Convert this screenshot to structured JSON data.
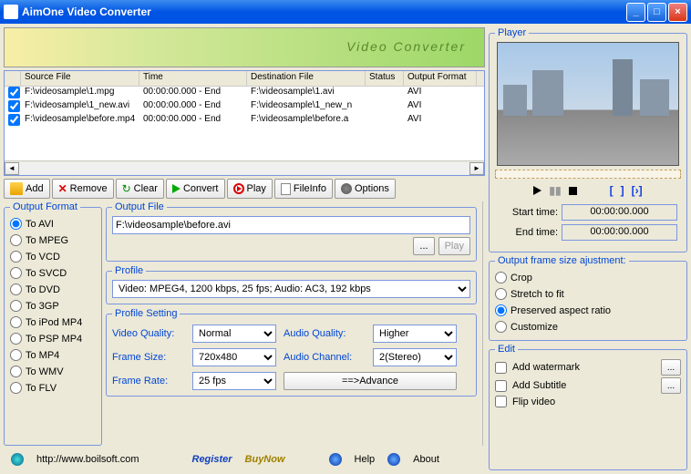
{
  "window": {
    "title": "AimOne Video Converter"
  },
  "banner": {
    "text": "Video Converter"
  },
  "table": {
    "headers": {
      "src": "Source File",
      "time": "Time",
      "dest": "Destination File",
      "status": "Status",
      "fmt": "Output Format"
    },
    "rows": [
      {
        "src": "F:\\videosample\\1.mpg",
        "time": "00:00:00.000 - End",
        "dest": "F:\\videosample\\1.avi",
        "status": "",
        "fmt": "AVI"
      },
      {
        "src": "F:\\videosample\\1_new.avi",
        "time": "00:00:00.000 - End",
        "dest": "F:\\videosample\\1_new_n",
        "status": "",
        "fmt": "AVI"
      },
      {
        "src": "F:\\videosample\\before.mp4",
        "time": "00:00:00.000 - End",
        "dest": "F:\\videosample\\before.a",
        "status": "",
        "fmt": "AVI"
      }
    ]
  },
  "toolbar": {
    "add": "Add",
    "remove": "Remove",
    "clear": "Clear",
    "convert": "Convert",
    "play": "Play",
    "fileinfo": "FileInfo",
    "options": "Options"
  },
  "format": {
    "legend": "Output Format",
    "items": [
      "To AVI",
      "To MPEG",
      "To VCD",
      "To SVCD",
      "To DVD",
      "To 3GP",
      "To iPod MP4",
      "To PSP MP4",
      "To MP4",
      "To WMV",
      "To FLV"
    ],
    "selected": 0
  },
  "output_file": {
    "legend": "Output File",
    "value": "F:\\videosample\\before.avi",
    "browse": "...",
    "play": "Play"
  },
  "profile": {
    "legend": "Profile",
    "value": "Video: MPEG4, 1200 kbps, 25 fps;  Audio: AC3, 192 kbps"
  },
  "profile_setting": {
    "legend": "Profile Setting",
    "vq_label": "Video Quality:",
    "vq": "Normal",
    "fs_label": "Frame Size:",
    "fs": "720x480",
    "fr_label": "Frame Rate:",
    "fr": "25 fps",
    "aq_label": "Audio Quality:",
    "aq": "Higher",
    "ac_label": "Audio Channel:",
    "ac": "2(Stereo)",
    "advance": "==>Advance"
  },
  "footer": {
    "url": "http://www.boilsoft.com",
    "register": "Register",
    "buynow": "BuyNow",
    "help": "Help",
    "about": "About"
  },
  "player": {
    "legend": "Player",
    "start_label": "Start time:",
    "start": "00:00:00.000",
    "end_label": "End  time:",
    "end": "00:00:00.000"
  },
  "ofs": {
    "legend": "Output frame size ajustment:",
    "items": [
      "Crop",
      "Stretch to fit",
      "Preserved aspect ratio",
      "Customize"
    ],
    "selected": 2
  },
  "edit": {
    "legend": "Edit",
    "watermark": "Add watermark",
    "subtitle": "Add Subtitle",
    "flip": "Flip video"
  }
}
